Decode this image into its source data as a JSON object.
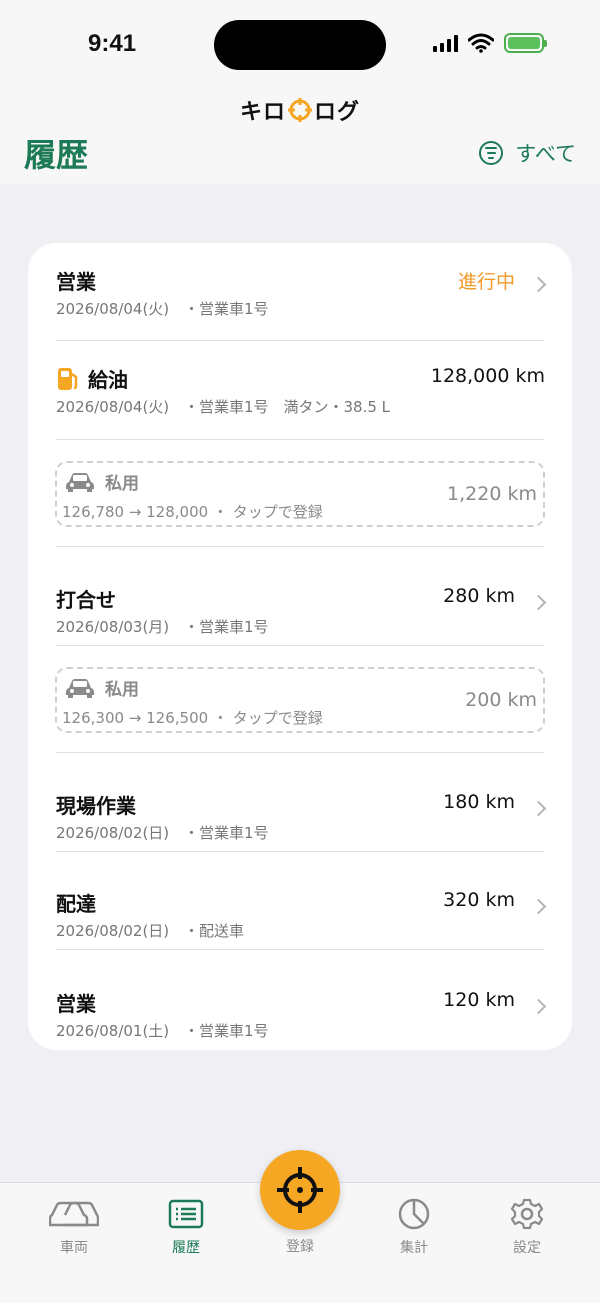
{
  "status_bar": {
    "time": "9:41"
  },
  "header": {
    "app_name_left": "キロ",
    "app_name_right": "ログ",
    "page_title": "履歴",
    "filter_label": "すべて"
  },
  "colors": {
    "accent": "#1d7a56",
    "orange": "#f5a623",
    "status": "#f09a2a"
  },
  "history": {
    "rows": [
      {
        "title": "営業",
        "date": "2026/08/04(火)",
        "detail": "・営業車1号",
        "status": "進行中"
      },
      {
        "title": "給油",
        "date": "2026/08/04(火)",
        "detail": "・営業車1号　満タン・38.5 L",
        "value": "128,000 km",
        "icon": "fuel-pump-icon"
      },
      {
        "title": "私用",
        "range": "126,780 → 128,000 ・ タップで登録",
        "value": "1,220 km",
        "icon": "car-icon"
      },
      {
        "title": "打合せ",
        "date": "2026/08/03(月)",
        "detail": "・営業車1号",
        "value": "280 km"
      },
      {
        "title": "私用",
        "range": "126,300 → 126,500 ・ タップで登録",
        "value": "200 km",
        "icon": "car-icon"
      },
      {
        "title": "現場作業",
        "date": "2026/08/02(日)",
        "detail": "・営業車1号",
        "value": "180 km"
      },
      {
        "title": "配達",
        "date": "2026/08/02(日)",
        "detail": "・配送車",
        "value": "320 km"
      },
      {
        "title": "営業",
        "date": "2026/08/01(土)",
        "detail": "・営業車1号",
        "value": "120 km"
      }
    ]
  },
  "tabbar": {
    "vehicles": "車両",
    "history": "履歴",
    "register": "登録",
    "summary": "集計",
    "settings": "設定"
  }
}
